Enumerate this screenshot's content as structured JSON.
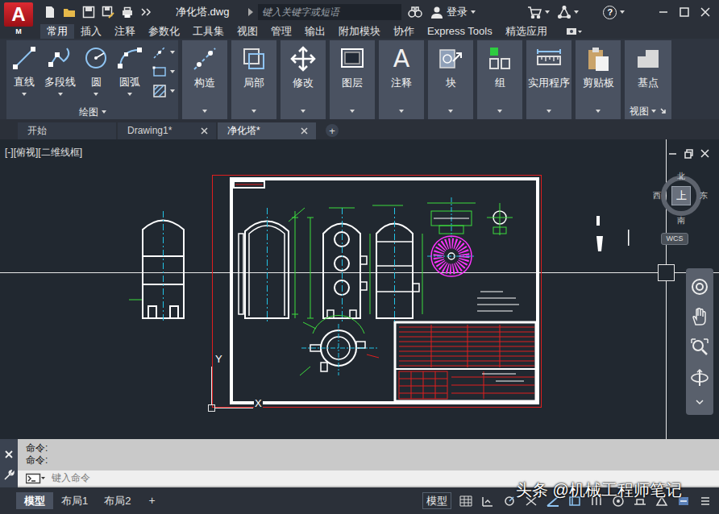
{
  "app": {
    "logo": "A",
    "edition": "M"
  },
  "window": {
    "title": "净化塔.dwg"
  },
  "search": {
    "placeholder": "键入关键字或短语"
  },
  "account": {
    "login": "登录"
  },
  "help": "?",
  "ribbon_tabs": [
    {
      "label": "常用",
      "selected": true
    },
    {
      "label": "插入",
      "selected": false
    },
    {
      "label": "注释",
      "selected": false
    },
    {
      "label": "参数化",
      "selected": false
    },
    {
      "label": "工具集",
      "selected": false
    },
    {
      "label": "视图",
      "selected": false
    },
    {
      "label": "管理",
      "selected": false
    },
    {
      "label": "输出",
      "selected": false
    },
    {
      "label": "附加模块",
      "selected": false
    },
    {
      "label": "协作",
      "selected": false
    },
    {
      "label": "Express Tools",
      "selected": false
    },
    {
      "label": "精选应用",
      "selected": false
    }
  ],
  "draw_panel": {
    "title": "绘图",
    "buttons": [
      {
        "label": "直线"
      },
      {
        "label": "多段线"
      },
      {
        "label": "圆"
      },
      {
        "label": "圆弧"
      }
    ]
  },
  "ribbon_groups": [
    {
      "label": "构造"
    },
    {
      "label": "局部"
    },
    {
      "label": "修改"
    },
    {
      "label": "图层"
    },
    {
      "label": "注释",
      "glyph": "A"
    },
    {
      "label": "块"
    },
    {
      "label": "组"
    },
    {
      "label": "实用程序"
    },
    {
      "label": "剪贴板"
    }
  ],
  "view_panel": {
    "title": "视图",
    "button": "基点"
  },
  "file_tabs": [
    {
      "label": "开始",
      "selected": false,
      "closable": false
    },
    {
      "label": "Drawing1*",
      "selected": false,
      "closable": true
    },
    {
      "label": "净化塔*",
      "selected": true,
      "closable": true
    }
  ],
  "new_tab": "+",
  "viewport": {
    "label": "[-][俯视][二维线框]"
  },
  "viewcube": {
    "north": "北",
    "south": "南",
    "east": "东",
    "west": "西",
    "face": "上",
    "wcs": "WCS"
  },
  "ucs": {
    "x": "X",
    "y": "Y"
  },
  "command": {
    "history": [
      "命令:",
      "命令:"
    ],
    "placeholder": "键入命令"
  },
  "layout_tabs": [
    {
      "label": "模型",
      "selected": true
    },
    {
      "label": "布局1",
      "selected": false
    },
    {
      "label": "布局2",
      "selected": false
    }
  ],
  "new_layout": "+",
  "status": {
    "space": "模型"
  },
  "watermark": "头条 @机械工程师笔记"
}
